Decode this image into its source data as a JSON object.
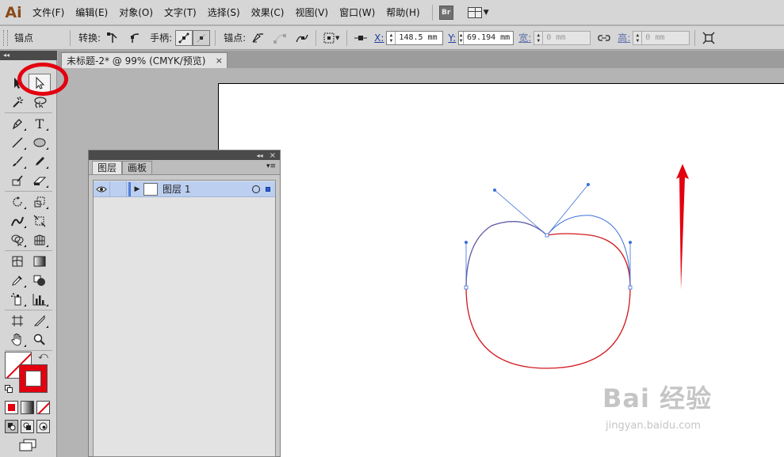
{
  "app": {
    "logo": "Ai"
  },
  "menu": {
    "items": [
      "文件(F)",
      "编辑(E)",
      "对象(O)",
      "文字(T)",
      "选择(S)",
      "效果(C)",
      "视图(V)",
      "窗口(W)",
      "帮助(H)"
    ],
    "bridge_label": "Br"
  },
  "controlbar": {
    "context_label": "锚点",
    "convert_label": "转换:",
    "handles_label": "手柄:",
    "anchors_label": "锚点:",
    "x_label": "X:",
    "x_value": "148.5 mm",
    "y_label": "Y:",
    "y_value": "69.194 mm",
    "w_label": "宽:",
    "w_value": "0 mm",
    "h_label": "高:",
    "h_value": "0 mm"
  },
  "document": {
    "tab_title": "未标题-2* @ 99% (CMYK/预览)",
    "close_glyph": "×"
  },
  "layers_panel": {
    "tabs": [
      "图层",
      "画板"
    ],
    "active_tab": "图层",
    "collapse_glyph": "◂◂",
    "close_glyph": "×",
    "menu_glyph": "▾≡",
    "layers": [
      {
        "name": "图层 1",
        "visible": true,
        "selected": true,
        "color": "#4f7dd4"
      }
    ]
  },
  "toolbox": {
    "collapse_glyph": "◂◂",
    "selected_tool": "direct-selection"
  },
  "artwork": {
    "path_color": "#d2191e",
    "handle_color": "#3b6fd6",
    "annotation_color": "#e3000f"
  },
  "watermark": {
    "logo": "Bai 经验",
    "url": "jingyan.baidu.com"
  }
}
